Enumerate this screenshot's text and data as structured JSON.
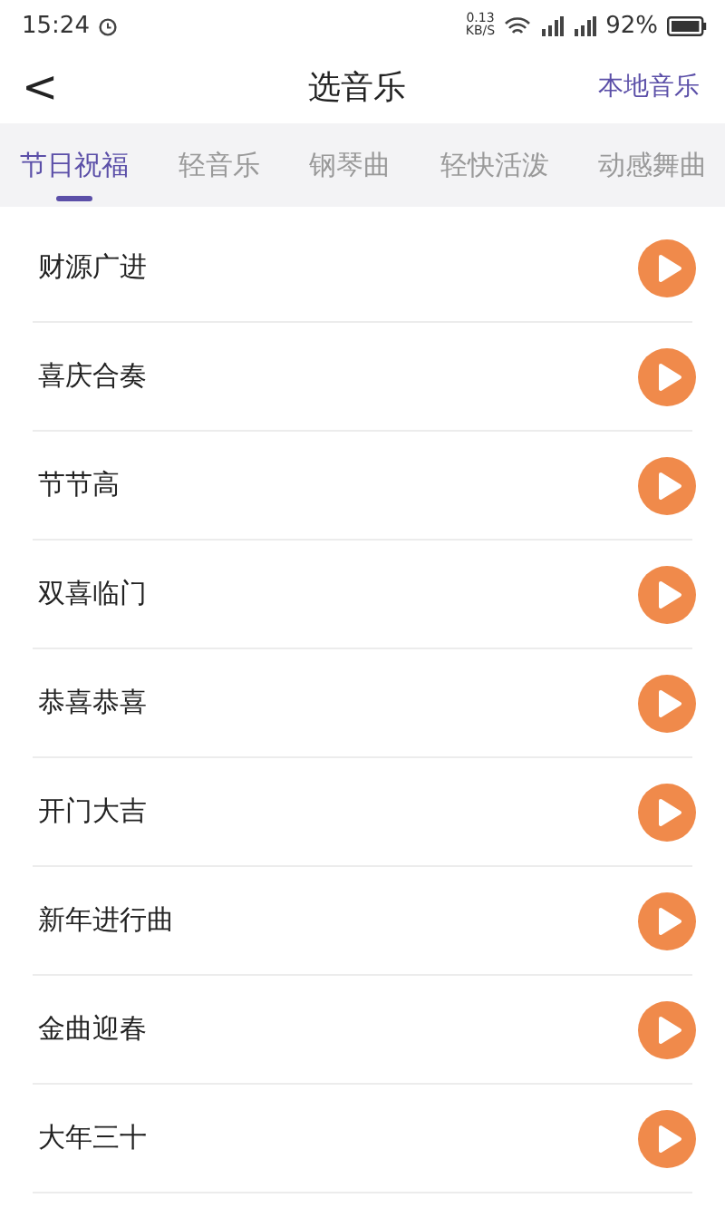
{
  "status_bar": {
    "time": "15:24",
    "speed_value": "0.13",
    "speed_unit": "KB/S",
    "battery": "92%"
  },
  "header": {
    "back": "<",
    "title": "选音乐",
    "action": "本地音乐"
  },
  "tabs": [
    {
      "label": "节日祝福",
      "selected": true
    },
    {
      "label": "轻音乐",
      "selected": false
    },
    {
      "label": "钢琴曲",
      "selected": false
    },
    {
      "label": "轻快活泼",
      "selected": false
    },
    {
      "label": "动感舞曲",
      "selected": false
    }
  ],
  "songs": [
    {
      "title": "财源广进"
    },
    {
      "title": "喜庆合奏"
    },
    {
      "title": "节节高"
    },
    {
      "title": "双喜临门"
    },
    {
      "title": "恭喜恭喜"
    },
    {
      "title": "开门大吉"
    },
    {
      "title": "新年进行曲"
    },
    {
      "title": "金曲迎春"
    },
    {
      "title": "大年三十"
    }
  ]
}
